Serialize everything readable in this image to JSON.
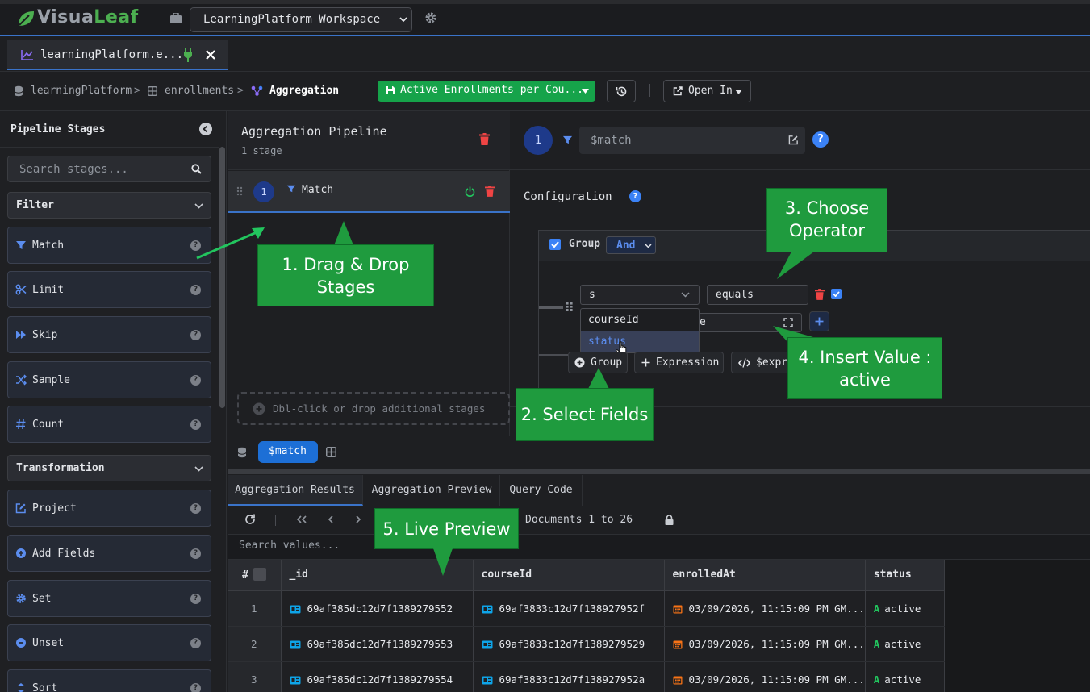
{
  "app": {
    "logo_part1": "Visua",
    "logo_part2": "Leaf",
    "workspace": "LearningPlatform Workspace"
  },
  "tab": {
    "label": "learningPlatform.e..."
  },
  "breadcrumb": {
    "database": "learningPlatform",
    "collection": "enrollments",
    "current": "Aggregation",
    "aggregation_name": "Active Enrollments per Cou...",
    "open_in": "Open In"
  },
  "sidebar": {
    "title": "Pipeline Stages",
    "search_placeholder": "Search stages...",
    "categories": [
      "Filter",
      "Transformation"
    ],
    "stages": [
      "Match",
      "Limit",
      "Skip",
      "Sample",
      "Count",
      "Project",
      "Add Fields",
      "Set",
      "Unset",
      "Sort"
    ]
  },
  "pipeline": {
    "title": "Aggregation Pipeline",
    "subtitle": "1 stage",
    "stage_number": "1",
    "stage_label": "Match",
    "drop_hint": "Dbl-click or drop additional stages"
  },
  "config": {
    "stage_number": "1",
    "stage_name": "$match",
    "title": "Configuration",
    "group_label": "Group",
    "combinator": "And",
    "field_value": "s",
    "operator": "equals",
    "value_tail": "e",
    "dropdown_options": [
      "courseId",
      "status"
    ],
    "btn_group": "Group",
    "btn_expression": "Expression",
    "btn_expr": "$expr"
  },
  "callouts": {
    "c1": "1. Drag & Drop Stages",
    "c2": "2. Select Fields",
    "c3": "3. Choose Operator",
    "c4": "4. Insert Value : active",
    "c5": "5. Live Preview"
  },
  "strip": {
    "chip": "$match"
  },
  "results": {
    "tabs": [
      "Aggregation Results",
      "Aggregation Preview",
      "Query Code"
    ],
    "doc_count": "Documents 1 to 26",
    "search_placeholder": "Search values...",
    "columns": [
      "#",
      "_id",
      "courseId",
      "enrolledAt",
      "status"
    ],
    "rows": [
      {
        "n": "1",
        "id": "69af385dc12d7f1389279552",
        "course": "69af3833c12d7f138927952f",
        "date": "03/09/2026, 11:15:09 PM GM...",
        "status": "active"
      },
      {
        "n": "2",
        "id": "69af385dc12d7f1389279553",
        "course": "69af3833c12d7f1389279529",
        "date": "03/09/2026, 11:15:09 PM GM...",
        "status": "active"
      },
      {
        "n": "3",
        "id": "69af385dc12d7f1389279554",
        "course": "69af3833c12d7f138927952a",
        "date": "03/09/2026, 11:15:09 PM GM...",
        "status": "active"
      }
    ]
  },
  "colors": {
    "accent": "#3a73c9",
    "callout": "#1f9b3e",
    "save_green": "#16a34a",
    "delete_red": "#ef4444"
  }
}
